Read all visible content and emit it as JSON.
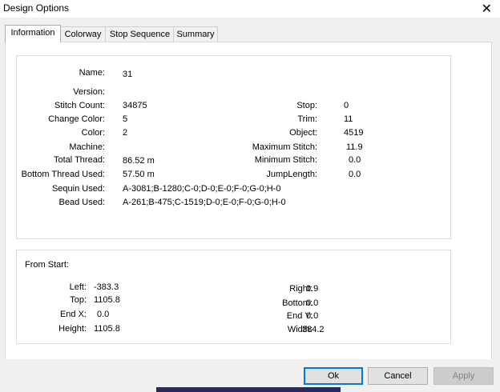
{
  "window": {
    "title": "Design Options"
  },
  "tabs": [
    {
      "label": "Information",
      "active": true
    },
    {
      "label": "Colorway",
      "active": false
    },
    {
      "label": "Stop Sequence",
      "active": false
    },
    {
      "label": "Summary",
      "active": false
    }
  ],
  "info": {
    "left": [
      {
        "label": "Name:",
        "value": "31"
      },
      {
        "label": "Version:",
        "value": ""
      },
      {
        "label": "Stitch Count:",
        "value": "34875"
      },
      {
        "label": "Change Color:",
        "value": "5"
      },
      {
        "label": "Color:",
        "value": "2"
      },
      {
        "label": "Machine:",
        "value": ""
      },
      {
        "label": "Total Thread:",
        "value": "86.52 m"
      },
      {
        "label": "Bottom Thread Used:",
        "value": "57.50 m"
      },
      {
        "label": "Sequin Used:",
        "value": "A-3081;B-1280;C-0;D-0;E-0;F-0;G-0;H-0"
      },
      {
        "label": "Bead Used:",
        "value": "A-261;B-475;C-1519;D-0;E-0;F-0;G-0;H-0"
      }
    ],
    "right": [
      {
        "label": "Stop:",
        "value": "0"
      },
      {
        "label": "Trim:",
        "value": "11"
      },
      {
        "label": "Object:",
        "value": "4519"
      },
      {
        "label": "Maximum Stitch:",
        "value": "11.9"
      },
      {
        "label": "Minimum Stitch:",
        "value": "0.0"
      },
      {
        "label": "JumpLength:",
        "value": "0.0"
      }
    ]
  },
  "from_start": {
    "heading": "From Start:",
    "left": [
      {
        "label": "Left:",
        "value": "-383.3"
      },
      {
        "label": "Top:",
        "value": "1105.8"
      },
      {
        "label": "End X:",
        "value": "0.0"
      },
      {
        "label": "Height:",
        "value": "1105.8"
      }
    ],
    "right": [
      {
        "label": "Right:",
        "value": "0.9"
      },
      {
        "label": "Bottom:",
        "value": "0.0"
      },
      {
        "label": "End Y:",
        "value": "0.0"
      },
      {
        "label": "Width:",
        "value": "384.2"
      }
    ]
  },
  "buttons": {
    "ok": "Ok",
    "cancel": "Cancel",
    "apply": "Apply"
  },
  "icons": {
    "close": "close-icon"
  },
  "colors": {
    "accent": "#0078d7"
  }
}
